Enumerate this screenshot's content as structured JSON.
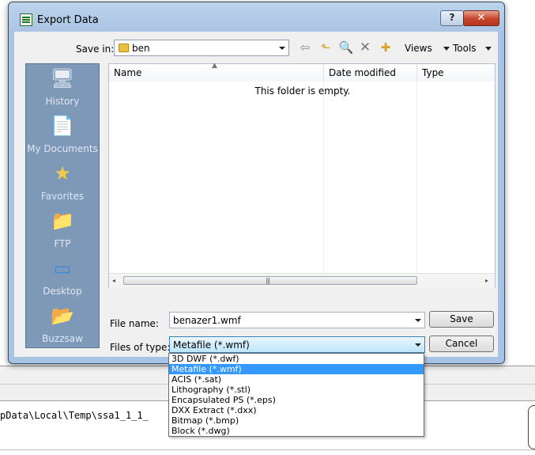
{
  "window": {
    "title": "Export Data",
    "help_glyph": "?",
    "close_glyph": "✕"
  },
  "toolbar": {
    "save_in_label": "Save in:",
    "folder": "ben",
    "back_glyph": "⇦",
    "up_glyph": "⬑",
    "search_glyph": "🔍",
    "delete_glyph": "✕",
    "newfolder_glyph": "✚",
    "views_label": "Views",
    "tools_label": "Tools"
  },
  "places": [
    {
      "label": "History",
      "icon": "history-icon",
      "glyph": "🖥"
    },
    {
      "label": "My Documents",
      "icon": "my-documents-icon",
      "glyph": "📄"
    },
    {
      "label": "Favorites",
      "icon": "favorites-icon",
      "glyph": "★"
    },
    {
      "label": "FTP",
      "icon": "ftp-icon",
      "glyph": "📁"
    },
    {
      "label": "Desktop",
      "icon": "desktop-icon",
      "glyph": "▭"
    },
    {
      "label": "Buzzsaw",
      "icon": "buzzsaw-icon",
      "glyph": "📂"
    }
  ],
  "filelist": {
    "columns": [
      "Name",
      "Date modified",
      "Type"
    ],
    "empty_message": "This folder is empty.",
    "scroll_left": "◂",
    "scroll_right": "▸",
    "grip": "|||"
  },
  "form": {
    "file_name_label": "File name:",
    "file_name_value": "benazer1.wmf",
    "file_type_label": "Files of type:",
    "file_type_value": "Metafile (*.wmf)",
    "save_button": "Save",
    "cancel_button": "Cancel"
  },
  "file_type_options": [
    "3D DWF (*.dwf)",
    "Metafile (*.wmf)",
    "ACIS (*.sat)",
    "Lithography (*.stl)",
    "Encapsulated PS (*.eps)",
    "DXX Extract (*.dxx)",
    "Bitmap (*.bmp)",
    "Block (*.dwg)"
  ],
  "selected_option_index": 1,
  "background": {
    "path_text": "pData\\Local\\Temp\\ssa1_1_1_"
  },
  "colors": {
    "selection": "#3399ff",
    "places_bar": "#7e98b8",
    "close_button": "#c7442b"
  }
}
